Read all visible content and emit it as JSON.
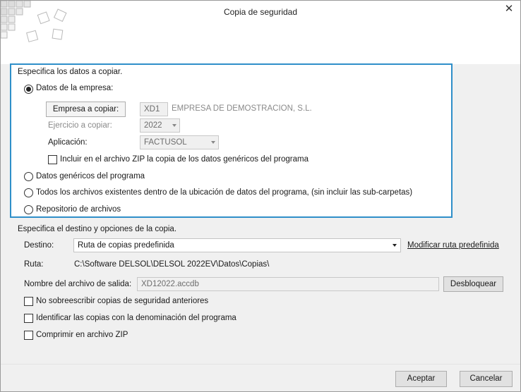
{
  "window": {
    "title": "Copia de seguridad"
  },
  "section_data": {
    "heading": "Especifica los datos a copiar.",
    "empresa": {
      "radio_label": "Datos de la empresa:",
      "empresa_label": "Empresa a copiar:",
      "empresa_code": "XD1",
      "empresa_name": "EMPRESA DE DEMOSTRACION, S.L.",
      "ejercicio_label": "Ejercicio a copiar:",
      "ejercicio_value": "2022",
      "aplicacion_label": "Aplicación:",
      "aplicacion_value": "FACTUSOL",
      "zip_checkbox_label": "Incluir en el archivo ZIP la copia de los datos genéricos del programa",
      "zip_checked": false
    },
    "options": [
      {
        "label": "Datos genéricos del programa",
        "checked": false
      },
      {
        "label": "Todos los archivos existentes dentro de la ubicación de datos del programa, (sin incluir las sub-carpetas)",
        "checked": false
      },
      {
        "label": "Repositorio de archivos",
        "checked": false
      }
    ],
    "selected": "empresa"
  },
  "destination": {
    "heading": "Especifica el destino y opciones de la copia.",
    "destino_label": "Destino:",
    "destino_value": "Ruta de copias predefinida",
    "modify_link": "Modificar ruta predefinida",
    "ruta_label": "Ruta:",
    "ruta_value": "C:\\Software DELSOL\\DELSOL 2022EV\\Datos\\Copias\\",
    "filename_label": "Nombre del archivo de salida:",
    "filename_value": "XD12022.accdb",
    "unlock_button": "Desbloquear"
  },
  "checkboxes": [
    {
      "label": "No sobreescribir copias de seguridad anteriores",
      "checked": false
    },
    {
      "label": "Identificar las copias con la denominación del programa",
      "checked": false
    },
    {
      "label": "Comprimir en archivo ZIP",
      "checked": false
    }
  ],
  "footer": {
    "accept": "Aceptar",
    "cancel": "Cancelar"
  },
  "colors": {
    "group_border": "#2f8fc9",
    "background": "#f0f0f0"
  }
}
